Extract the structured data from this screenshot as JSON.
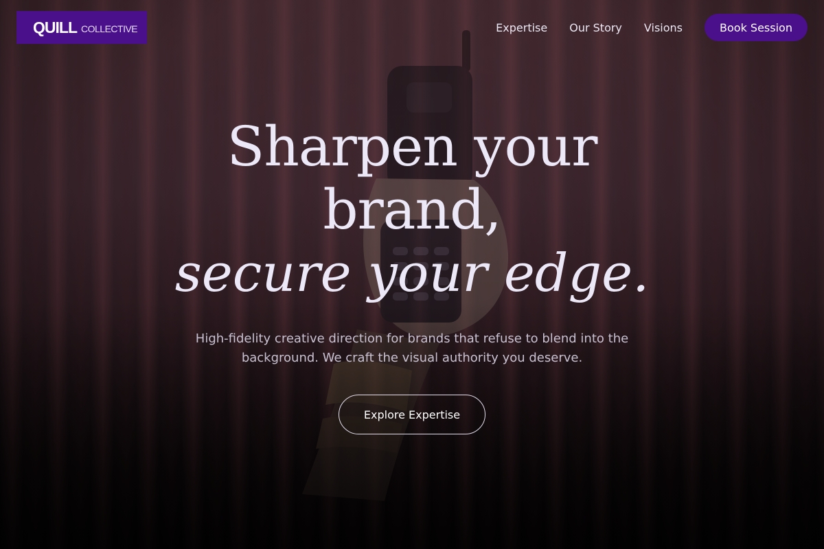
{
  "brand": {
    "name": "QUILL",
    "subname": "COLLECTIVE",
    "color": "#4a0f8a"
  },
  "nav": {
    "links": [
      "Expertise",
      "Our Story",
      "Visions"
    ],
    "cta_label": "Book Session"
  },
  "hero": {
    "headline_line1": "Sharpen your",
    "headline_line2": "brand,",
    "headline_line3": "secure your edge.",
    "subtext": "High-fidelity creative direction for brands that refuse to blend into the background. We craft the visual authority you deserve.",
    "cta_label": "Explore Expertise",
    "background_image": "hand-holding-flip-phone-photo"
  }
}
